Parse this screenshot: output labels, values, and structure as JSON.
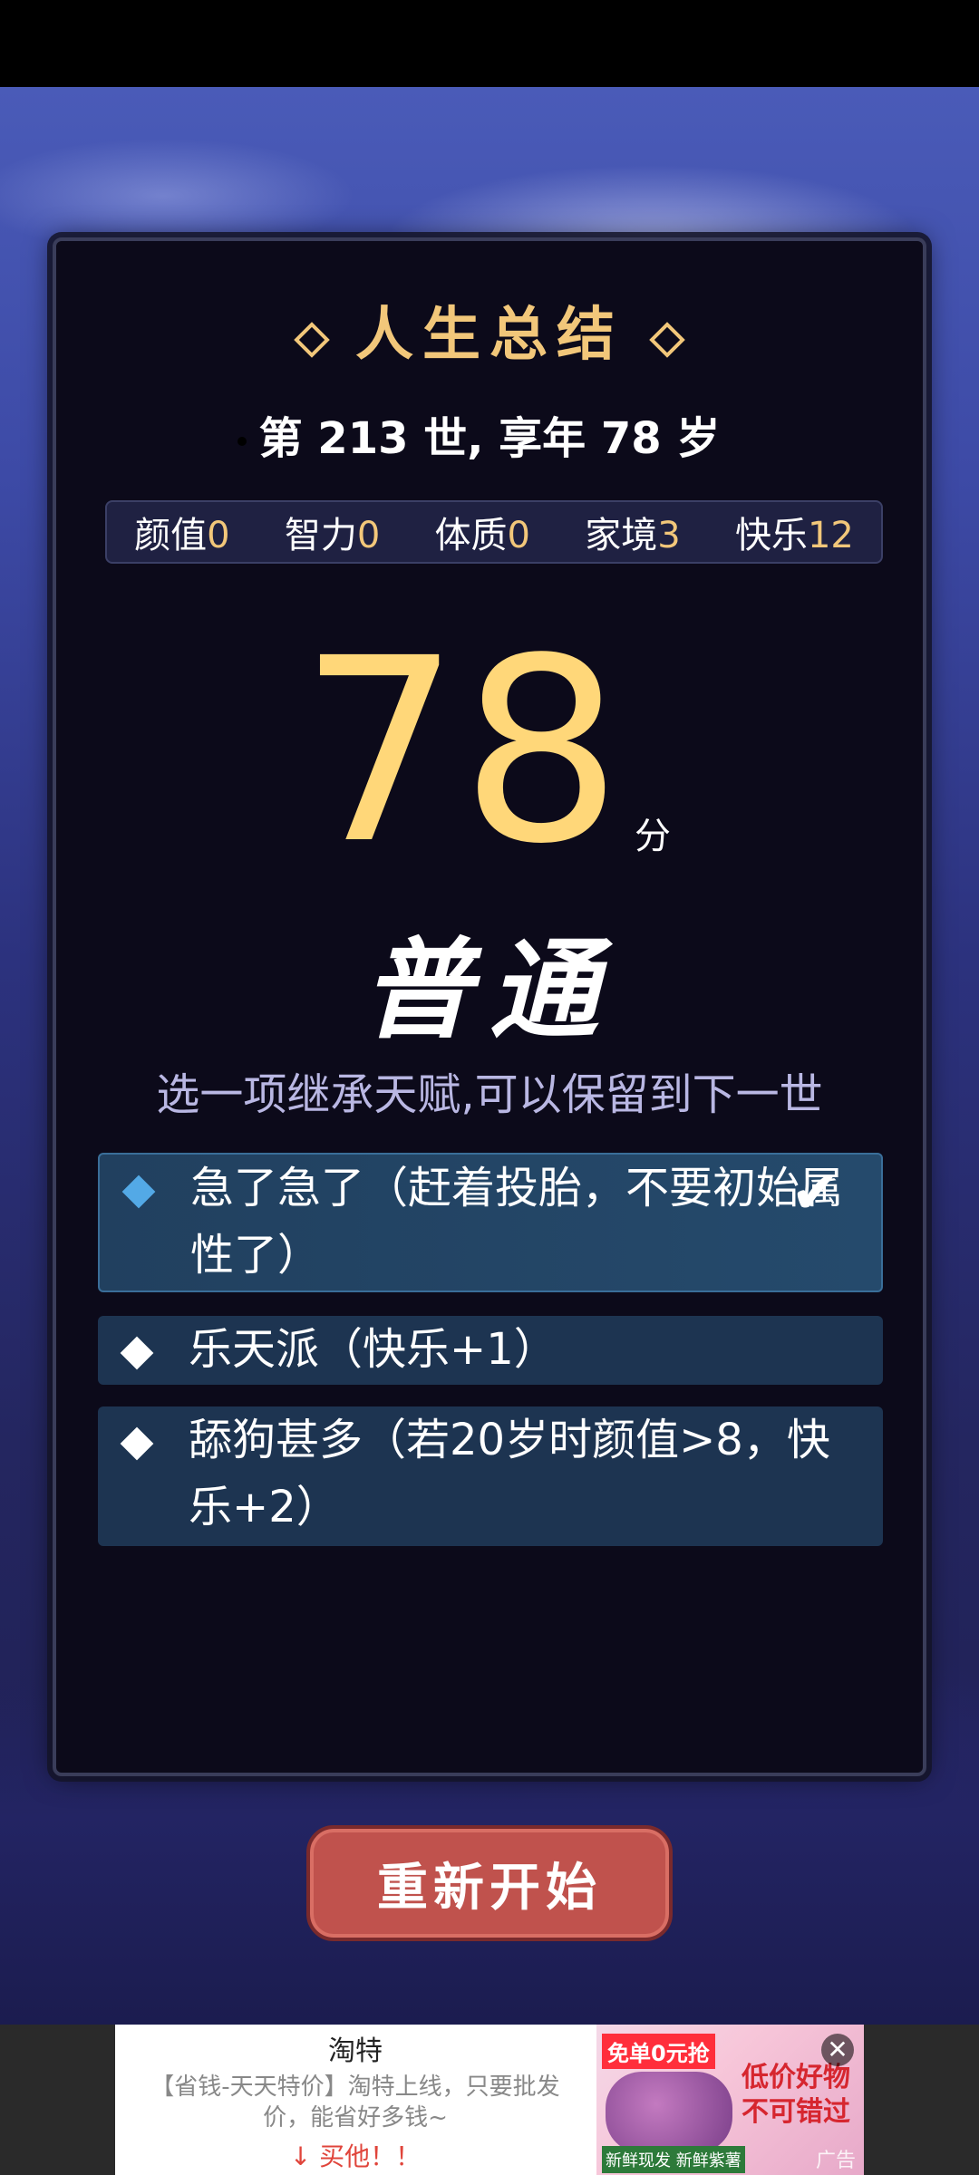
{
  "summary": {
    "title": "人生总结",
    "life_line": "第 213 世, 享年 78 岁"
  },
  "attributes": [
    {
      "label": "颜值",
      "value": "0"
    },
    {
      "label": "智力",
      "value": "0"
    },
    {
      "label": "体质",
      "value": "0"
    },
    {
      "label": "家境",
      "value": "3"
    },
    {
      "label": "快乐",
      "value": "12"
    }
  ],
  "score": {
    "value": "78",
    "unit": "分",
    "grade": "普通"
  },
  "inherit": {
    "prompt": "选一项继承天赋,可以保留到下一世",
    "options": [
      {
        "text": "急了急了（赶着投胎，不要初始属性了）",
        "selected": true
      },
      {
        "text": "乐天派（快乐+1）",
        "selected": false
      },
      {
        "text": "舔狗甚多（若20岁时颜值>8，快乐+2）",
        "selected": false
      }
    ]
  },
  "restart_label": "重新开始",
  "ad": {
    "title": "淘特",
    "description": "【省钱-天天特价】淘特上线，只要批发价，能省好多钱~",
    "cta": "↓ 买他！！",
    "badge": "免单0元抢",
    "slogan": "低价好物不可错过",
    "bottom": "新鲜现发 新鲜紫薯",
    "label": "广告",
    "close": "✕"
  },
  "colors": {
    "accent": "#f2c77a",
    "score": "#ffd779",
    "option_bg": "#1d3451",
    "selected_bullet": "#53a9e6",
    "restart_button": "#c0524d"
  }
}
